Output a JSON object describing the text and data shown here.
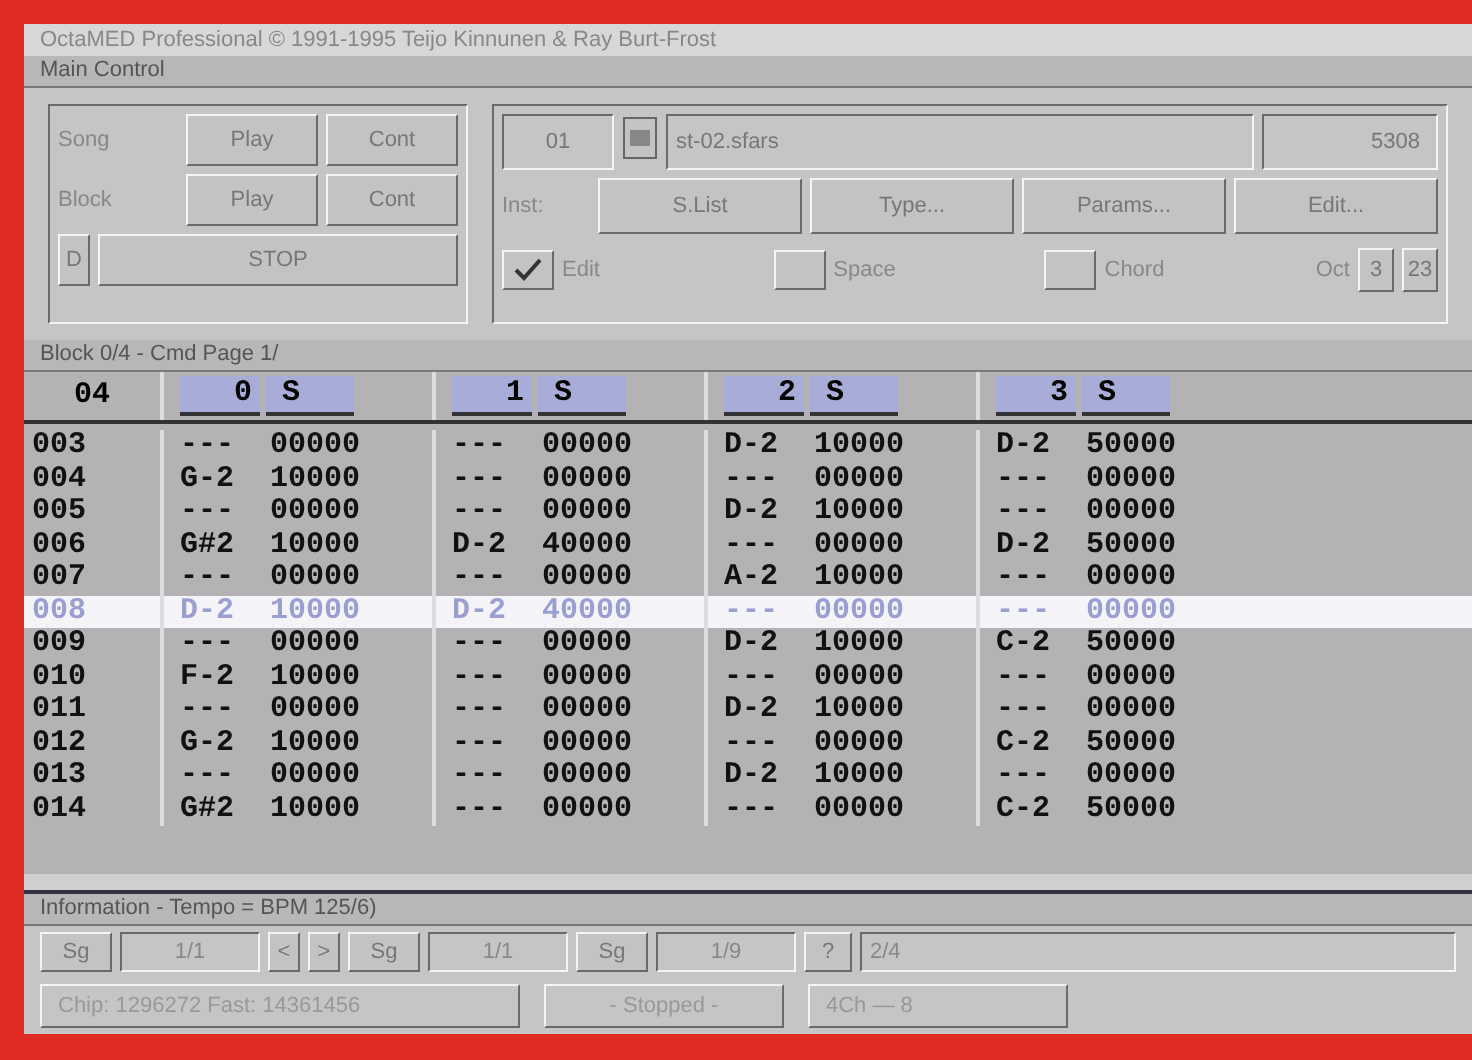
{
  "window": {
    "title": "OctaMED Professional © 1991-1995 Teijo Kinnunen & Ray Burt-Frost"
  },
  "main_control": {
    "title": "Main Control",
    "transport": [
      {
        "label": "Song",
        "buttons": [
          "Play",
          "Cont"
        ]
      },
      {
        "label": "Block",
        "buttons": [
          "Play",
          "Cont"
        ]
      }
    ],
    "stop": {
      "key": "D",
      "label": "STOP"
    },
    "instrument": {
      "number": "01",
      "name": "st-02.sfars",
      "size": "5308",
      "label": "Inst:",
      "buttons": [
        "S.List",
        "Type...",
        "Params...",
        "Edit..."
      ]
    },
    "options": [
      {
        "label": "Edit",
        "checked": true
      },
      {
        "label": "Space",
        "checked": false
      },
      {
        "label": "Chord",
        "checked": false
      }
    ],
    "octave": {
      "label": "Oct",
      "value": "3",
      "extra": "23"
    }
  },
  "editor": {
    "title": "Block 0/4 - Cmd Page 1/",
    "block": "04",
    "tracks": [
      {
        "number": "0",
        "solo": "S"
      },
      {
        "number": "1",
        "solo": "S"
      },
      {
        "number": "2",
        "solo": "S"
      },
      {
        "number": "3",
        "solo": "S"
      }
    ],
    "rows": [
      {
        "line": "003",
        "selected": false,
        "cells": [
          [
            "---",
            "00000"
          ],
          [
            "---",
            "00000"
          ],
          [
            "D-2",
            "10000"
          ],
          [
            "D-2",
            "50000"
          ]
        ]
      },
      {
        "line": "004",
        "selected": false,
        "cells": [
          [
            "G-2",
            "10000"
          ],
          [
            "---",
            "00000"
          ],
          [
            "---",
            "00000"
          ],
          [
            "---",
            "00000"
          ]
        ]
      },
      {
        "line": "005",
        "selected": false,
        "cells": [
          [
            "---",
            "00000"
          ],
          [
            "---",
            "00000"
          ],
          [
            "D-2",
            "10000"
          ],
          [
            "---",
            "00000"
          ]
        ]
      },
      {
        "line": "006",
        "selected": false,
        "cells": [
          [
            "G#2",
            "10000"
          ],
          [
            "D-2",
            "40000"
          ],
          [
            "---",
            "00000"
          ],
          [
            "D-2",
            "50000"
          ]
        ]
      },
      {
        "line": "007",
        "selected": false,
        "cells": [
          [
            "---",
            "00000"
          ],
          [
            "---",
            "00000"
          ],
          [
            "A-2",
            "10000"
          ],
          [
            "---",
            "00000"
          ]
        ]
      },
      {
        "line": "008",
        "selected": true,
        "cells": [
          [
            "D-2",
            "10000"
          ],
          [
            "D-2",
            "40000"
          ],
          [
            "---",
            "00000"
          ],
          [
            "---",
            "00000"
          ]
        ]
      },
      {
        "line": "009",
        "selected": false,
        "cells": [
          [
            "---",
            "00000"
          ],
          [
            "---",
            "00000"
          ],
          [
            "D-2",
            "10000"
          ],
          [
            "C-2",
            "50000"
          ]
        ]
      },
      {
        "line": "010",
        "selected": false,
        "cells": [
          [
            "F-2",
            "10000"
          ],
          [
            "---",
            "00000"
          ],
          [
            "---",
            "00000"
          ],
          [
            "---",
            "00000"
          ]
        ]
      },
      {
        "line": "011",
        "selected": false,
        "cells": [
          [
            "---",
            "00000"
          ],
          [
            "---",
            "00000"
          ],
          [
            "D-2",
            "10000"
          ],
          [
            "---",
            "00000"
          ]
        ]
      },
      {
        "line": "012",
        "selected": false,
        "cells": [
          [
            "G-2",
            "10000"
          ],
          [
            "---",
            "00000"
          ],
          [
            "---",
            "00000"
          ],
          [
            "C-2",
            "50000"
          ]
        ]
      },
      {
        "line": "013",
        "selected": false,
        "cells": [
          [
            "---",
            "00000"
          ],
          [
            "---",
            "00000"
          ],
          [
            "D-2",
            "10000"
          ],
          [
            "---",
            "00000"
          ]
        ]
      },
      {
        "line": "014",
        "selected": false,
        "cells": [
          [
            "G#2",
            "10000"
          ],
          [
            "---",
            "00000"
          ],
          [
            "---",
            "00000"
          ],
          [
            "C-2",
            "50000"
          ]
        ]
      }
    ]
  },
  "information": {
    "title": "Information - Tempo = BPM 125/6)",
    "positions": [
      {
        "label": "Sg",
        "value": "1/1"
      },
      {
        "label": "Sg",
        "value": "1/1"
      },
      {
        "label": "Sg",
        "value": "1/9"
      }
    ],
    "arrows": [
      "<",
      ">"
    ],
    "sel": {
      "label": "?",
      "value": "2/4"
    },
    "status": [
      "Chip: 1296272 Fast: 14361456",
      "- Stopped -",
      "4Ch — 8"
    ]
  }
}
